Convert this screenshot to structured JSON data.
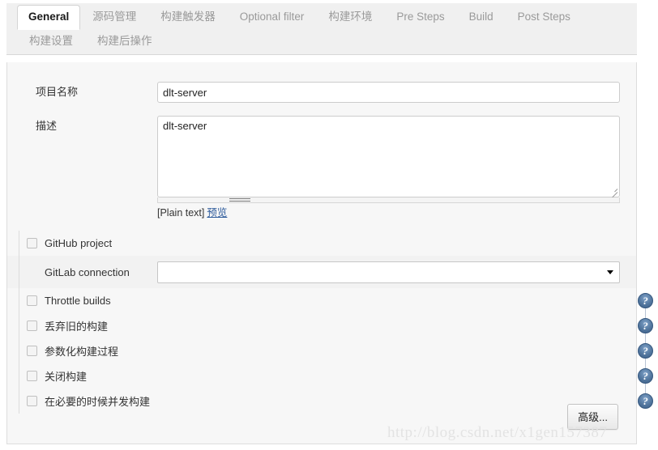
{
  "tabs": {
    "row1": [
      {
        "label": "General",
        "active": true
      },
      {
        "label": "源码管理",
        "active": false
      },
      {
        "label": "构建触发器",
        "active": false
      },
      {
        "label": "Optional filter",
        "active": false
      },
      {
        "label": "构建环境",
        "active": false
      },
      {
        "label": "Pre Steps",
        "active": false
      },
      {
        "label": "Build",
        "active": false
      },
      {
        "label": "Post Steps",
        "active": false
      }
    ],
    "row2": [
      {
        "label": "构建设置",
        "active": false
      },
      {
        "label": "构建后操作",
        "active": false
      }
    ]
  },
  "form": {
    "project_name": {
      "label": "项目名称",
      "value": "dlt-server",
      "placeholder": ""
    },
    "description": {
      "label": "描述",
      "value": "dlt-server",
      "placeholder": "",
      "markup_type": "[Plain text]",
      "preview_link": "预览"
    }
  },
  "options": {
    "github_project": {
      "label": "GitHub project",
      "checked": false
    },
    "gitlab_connection": {
      "label": "GitLab connection",
      "value": "",
      "options": [
        ""
      ]
    },
    "checkboxes": [
      {
        "label": "Throttle builds",
        "checked": false,
        "help": "?"
      },
      {
        "label": "丢弃旧的构建",
        "checked": false,
        "help": "?"
      },
      {
        "label": "参数化构建过程",
        "checked": false,
        "help": "?"
      },
      {
        "label": "关闭构建",
        "checked": false,
        "help": "?"
      },
      {
        "label": "在必要的时候并发构建",
        "checked": false,
        "help": "?"
      }
    ]
  },
  "footer": {
    "advanced_button": "高级..."
  },
  "watermark": {
    "text": "http://blog.csdn.net/x1gen157387"
  },
  "colors": {
    "link": "#2f5c9c",
    "help_icon": "#53779f",
    "panel_bg": "#f7f7f7",
    "tab_inactive": "#9a9a9a"
  }
}
